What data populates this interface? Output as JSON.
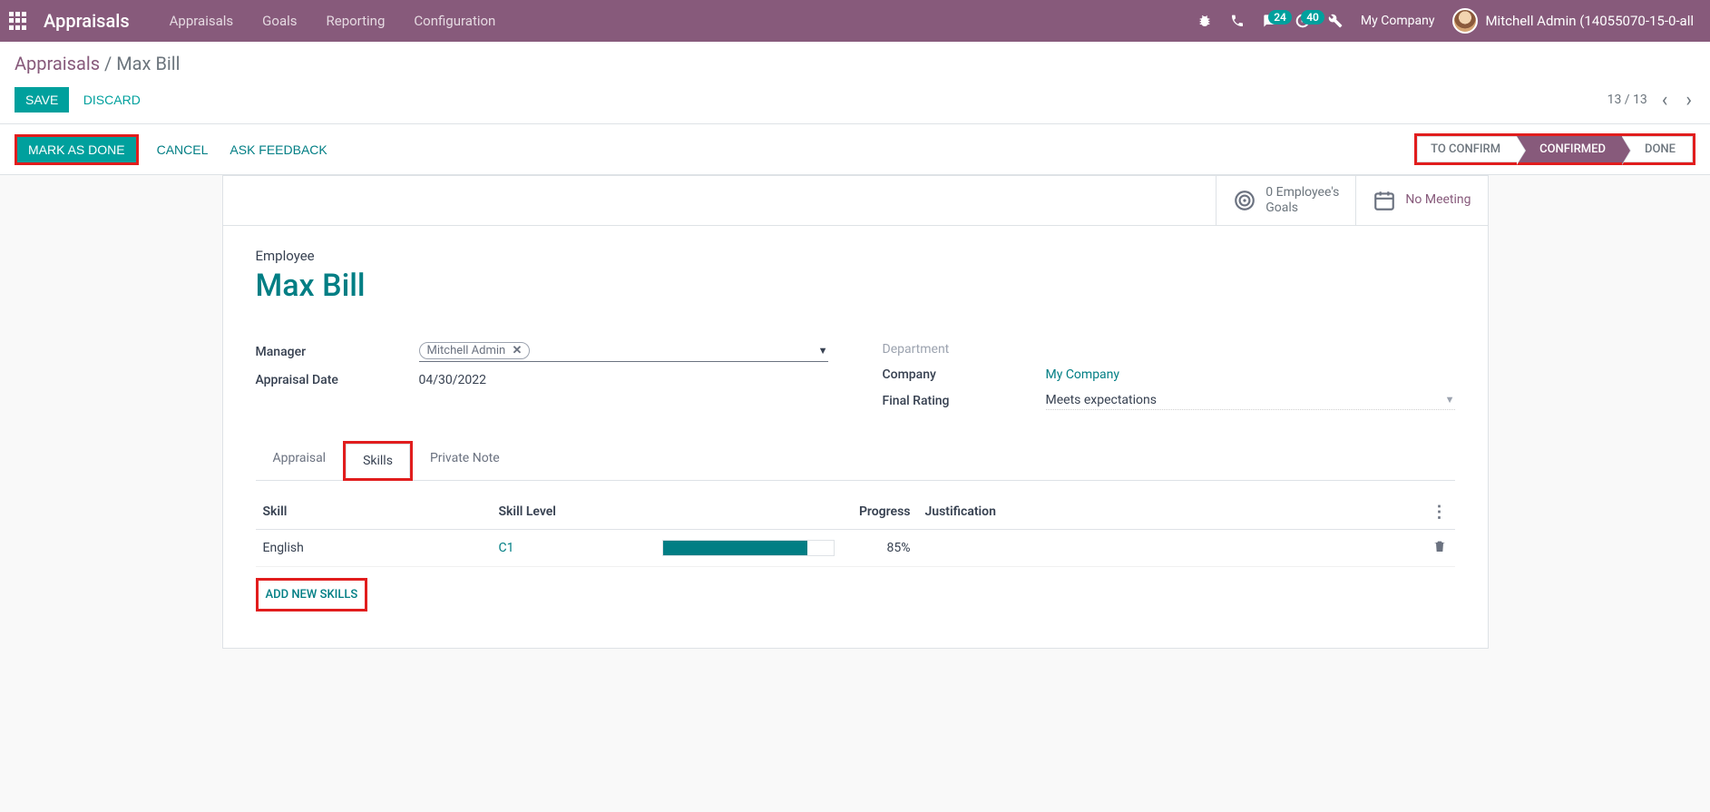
{
  "navbar": {
    "brand": "Appraisals",
    "links": [
      "Appraisals",
      "Goals",
      "Reporting",
      "Configuration"
    ],
    "chat_badge": "24",
    "activity_badge": "40",
    "company": "My Company",
    "user": "Mitchell Admin (14055070-15-0-all"
  },
  "breadcrumb": {
    "parent": "Appraisals",
    "current": "Max Bill"
  },
  "buttons": {
    "save": "Save",
    "discard": "Discard",
    "mark_done": "Mark as Done",
    "cancel": "Cancel",
    "ask_feedback": "Ask Feedback"
  },
  "pager": {
    "text": "13 / 13"
  },
  "status": {
    "steps": [
      "To Confirm",
      "Confirmed",
      "Done"
    ],
    "active_index": 1
  },
  "stat_buttons": {
    "goals_line1": "0 Employee's",
    "goals_line2": "Goals",
    "meeting": "No Meeting"
  },
  "form": {
    "employee_label": "Employee",
    "employee_name": "Max Bill",
    "manager_label": "Manager",
    "manager_value": "Mitchell Admin",
    "date_label": "Appraisal Date",
    "date_value": "04/30/2022",
    "department_label": "Department",
    "company_label": "Company",
    "company_value": "My Company",
    "rating_label": "Final Rating",
    "rating_value": "Meets expectations"
  },
  "tabs": {
    "appraisal": "Appraisal",
    "skills": "Skills",
    "private_note": "Private Note"
  },
  "skills_table": {
    "headers": {
      "skill": "Skill",
      "level": "Skill Level",
      "progress": "Progress",
      "justification": "Justification"
    },
    "rows": [
      {
        "skill": "English",
        "level": "C1",
        "progress_pct": 85,
        "progress_text": "85%"
      }
    ],
    "add_label": "Add New Skills"
  }
}
